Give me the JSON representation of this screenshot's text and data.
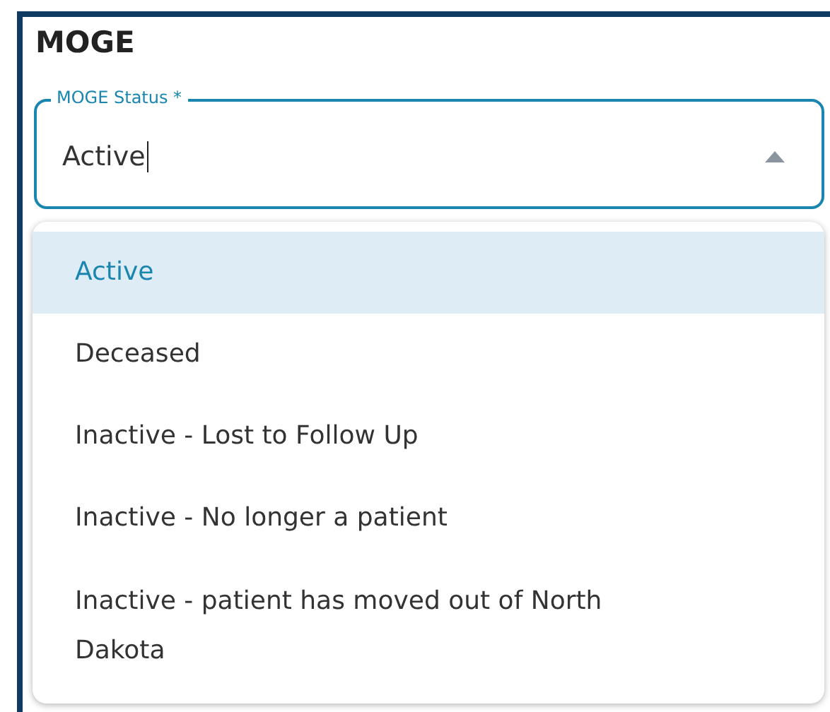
{
  "section": {
    "title": "MOGE"
  },
  "field": {
    "label": "MOGE Status *",
    "value": "Active",
    "expanded": true
  },
  "options": [
    {
      "label": "Active",
      "selected": true
    },
    {
      "label": "Deceased",
      "selected": false
    },
    {
      "label": "Inactive - Lost to Follow Up",
      "selected": false
    },
    {
      "label": "Inactive - No longer a patient",
      "selected": false
    },
    {
      "label": "Inactive - patient has moved out of North Dakota",
      "selected": false
    }
  ]
}
